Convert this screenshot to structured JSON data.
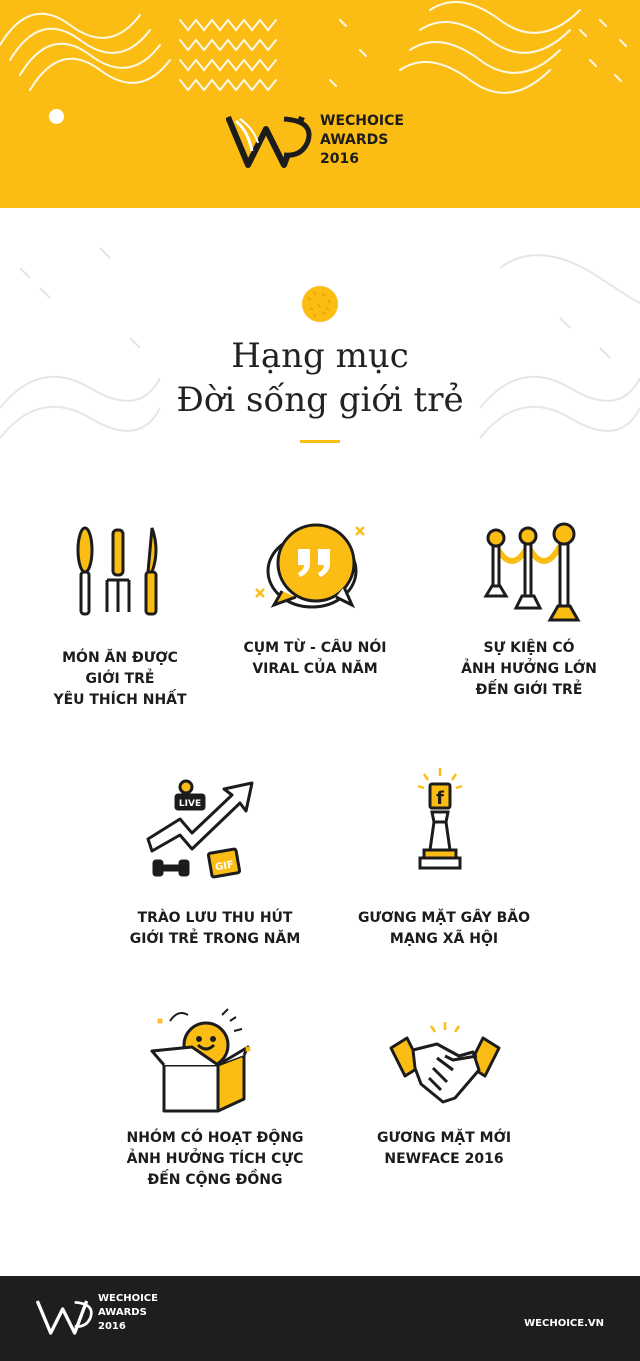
{
  "header": {
    "logo_lines": [
      "WECHOICE",
      "AWARDS",
      "2016"
    ]
  },
  "section": {
    "title_lines": [
      "Hạng mục",
      "Đời sống giới trẻ"
    ]
  },
  "categories": [
    {
      "icon": "utensils-icon",
      "lines": [
        "MÓN ĂN ĐƯỢC",
        "GIỚI TRẺ",
        "YÊU THÍCH NHẤT"
      ]
    },
    {
      "icon": "quote-bubble-icon",
      "lines": [
        "CỤM TỪ - CÂU NÓI",
        "VIRAL CỦA NĂM"
      ]
    },
    {
      "icon": "stanchion-icon",
      "lines": [
        "SỰ KIỆN CÓ",
        "ẢNH HƯỞNG LỚN",
        "ĐẾN GIỚI TRẺ"
      ]
    },
    {
      "icon": "trend-arrow-icon",
      "lines": [
        "TRÀO LƯU THU HÚT",
        "GIỚI TRẺ TRONG NĂM"
      ]
    },
    {
      "icon": "chess-king-icon",
      "lines": [
        "GƯƠNG MẶT GÂY BÃO",
        "MẠNG XÃ HỘI"
      ]
    },
    {
      "icon": "gift-box-icon",
      "lines": [
        "NHÓM CÓ HOẠT ĐỘNG",
        "ẢNH HƯỞNG TÍCH CỰC",
        "ĐẾN CỘNG ĐỒNG"
      ]
    },
    {
      "icon": "handshake-icon",
      "lines": [
        "GƯƠNG MẶT MỚI",
        "NEWFACE 2016"
      ]
    }
  ],
  "icon_text": {
    "live": "LIVE",
    "gif": "GIF",
    "fb": "f"
  },
  "footer": {
    "logo_lines": [
      "WECHOICE",
      "AWARDS",
      "2016"
    ],
    "site": "WECHOICE.VN"
  },
  "colors": {
    "accent": "#fbbd14",
    "dark": "#1e1e1e",
    "text": "#1c1c1c"
  }
}
